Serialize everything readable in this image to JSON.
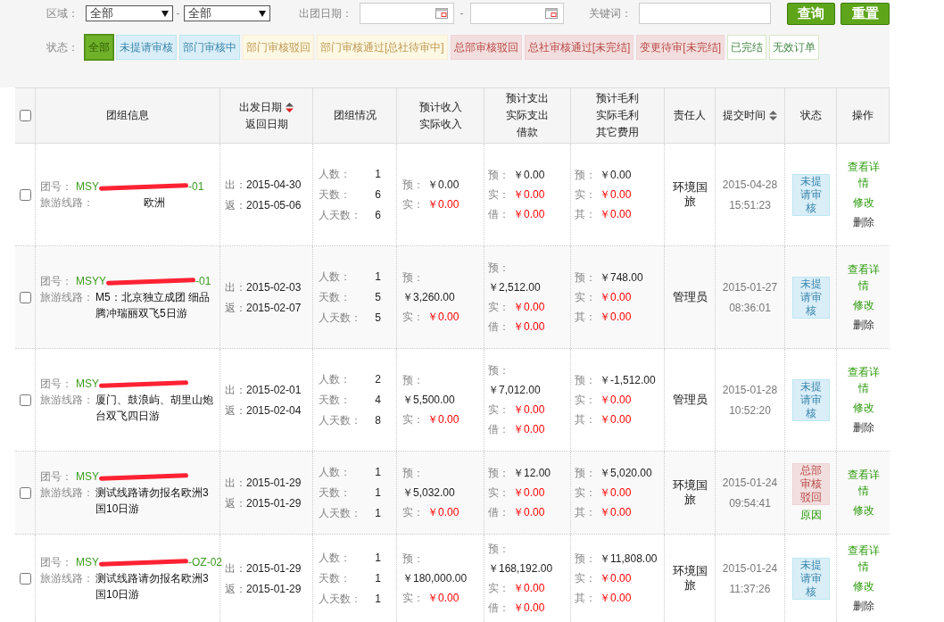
{
  "filters": {
    "region_label": "区域：",
    "region_1": "全部",
    "separator_1": "-",
    "region_2": "全部",
    "date_label": "出团日期：",
    "separator_2": "-",
    "keyword_label": "关键词：",
    "search_button": "查询",
    "reset_button": "重置"
  },
  "status_label": "状态：",
  "status_chips": [
    {
      "label": "全部",
      "kind": "all",
      "selected": true
    },
    {
      "label": "未提请审核",
      "kind": "blue",
      "selected": false
    },
    {
      "label": "部门审核中",
      "kind": "blue",
      "selected": false
    },
    {
      "label": "部门审核驳回",
      "kind": "orange",
      "selected": false
    },
    {
      "label": "部门审核通过[总社待审中]",
      "kind": "orange",
      "selected": false
    },
    {
      "label": "总部审核驳回",
      "kind": "red",
      "selected": false
    },
    {
      "label": "总社审核通过[未完结]",
      "kind": "red",
      "selected": false
    },
    {
      "label": "变更待审[未完结]",
      "kind": "red",
      "selected": false
    },
    {
      "label": "已完结",
      "kind": "green",
      "selected": false
    },
    {
      "label": "无效订单",
      "kind": "green",
      "selected": false
    }
  ],
  "table": {
    "select_all": {
      "checked": false
    },
    "columns": [
      {
        "lines": [
          "团组信息"
        ]
      },
      {
        "lines": [
          "出发日期",
          "返回日期"
        ],
        "sortable": true,
        "sorted": true
      },
      {
        "lines": [
          "团组情况"
        ]
      },
      {
        "lines": [
          "预计收入",
          "实际收入"
        ]
      },
      {
        "lines": [
          "预计支出",
          "实际支出",
          "借款"
        ]
      },
      {
        "lines": [
          "预计毛利",
          "实际毛利",
          "其它费用"
        ]
      },
      {
        "lines": [
          "责任人"
        ]
      },
      {
        "lines": [
          "提交时间"
        ],
        "sortable": true,
        "sorted": false
      },
      {
        "lines": [
          "状态"
        ]
      },
      {
        "lines": [
          "操作"
        ]
      }
    ],
    "rows": [
      {
        "checked": false,
        "no_label": "团号：",
        "no_head": "MSY",
        "no_tail": "-01",
        "route_label": "旅游线路：",
        "route": "欧洲",
        "depart": [
          "出：",
          "2015-04-30"
        ],
        "return": [
          "返：",
          "2015-05-06"
        ],
        "group": [
          [
            "人数：",
            "1"
          ],
          [
            "天数：",
            "6"
          ],
          [
            "人天数：",
            "6"
          ]
        ],
        "income": [
          {
            "label": "预：",
            "value": "￥0.00",
            "kind": "inline"
          },
          {
            "label": "实：",
            "value": "￥0.00",
            "kind": "inline"
          }
        ],
        "expense": [
          {
            "label": "预：",
            "value": "￥0.00",
            "kind": "inline"
          },
          {
            "label": "实：",
            "value": "￥0.00",
            "kind": "inline"
          },
          {
            "label": "借：",
            "value": "￥0.00",
            "kind": "inline"
          }
        ],
        "profit": [
          {
            "label": "预：",
            "value": "￥0.00",
            "kind": "inline"
          },
          {
            "label": "实：",
            "value": "￥0.00",
            "kind": "inline"
          },
          {
            "label": "其：",
            "value": "￥0.00",
            "kind": "inline"
          }
        ],
        "owner": "环境国旅",
        "time": [
          "2015-04-28",
          "15:51:23"
        ],
        "status": {
          "label": "未提请审核",
          "kind": "blue"
        },
        "actions": [
          "查看详情",
          "修改",
          "删除"
        ]
      },
      {
        "checked": false,
        "no_label": "团号：",
        "no_head": "MSYY",
        "no_tail": "-01",
        "route_label": "旅游线路：",
        "route": "M5：北京独立成团 细品腾冲瑞丽双飞5日游",
        "depart": [
          "出：",
          "2015-02-03"
        ],
        "return": [
          "返：",
          "2015-02-07"
        ],
        "group": [
          [
            "人数：",
            "1"
          ],
          [
            "天数：",
            "5"
          ],
          [
            "人天数：",
            "5"
          ]
        ],
        "income": [
          {
            "label": "预：",
            "value": "￥3,260.00",
            "kind": "stacked"
          },
          {
            "label": "实：",
            "value": "￥0.00",
            "kind": "inline"
          }
        ],
        "expense": [
          {
            "label": "预：",
            "value": "￥2,512.00",
            "kind": "stacked"
          },
          {
            "label": "实：",
            "value": "￥0.00",
            "kind": "inline"
          },
          {
            "label": "借：",
            "value": "￥0.00",
            "kind": "inline"
          }
        ],
        "profit": [
          {
            "label": "预：",
            "value": "￥748.00",
            "kind": "inline"
          },
          {
            "label": "实：",
            "value": "￥0.00",
            "kind": "inline"
          },
          {
            "label": "其：",
            "value": "￥0.00",
            "kind": "inline"
          }
        ],
        "owner": "管理员",
        "time": [
          "2015-01-27",
          "08:36:01"
        ],
        "status": {
          "label": "未提请审核",
          "kind": "blue"
        },
        "actions": [
          "查看详情",
          "修改",
          "删除"
        ]
      },
      {
        "checked": false,
        "no_label": "团号：",
        "no_head": "MSY",
        "route_label": "旅游线路：",
        "route": "厦门、鼓浪屿、胡里山炮台双飞四日游",
        "depart": [
          "出：",
          "2015-02-01"
        ],
        "return": [
          "返：",
          "2015-02-04"
        ],
        "group": [
          [
            "人数：",
            "2"
          ],
          [
            "天数：",
            "4"
          ],
          [
            "人天数：",
            "8"
          ]
        ],
        "income": [
          {
            "label": "预：",
            "value": "￥5,500.00",
            "kind": "stacked"
          },
          {
            "label": "实：",
            "value": "￥0.00",
            "kind": "inline"
          }
        ],
        "expense": [
          {
            "label": "预：",
            "value": "￥7,012.00",
            "kind": "stacked"
          },
          {
            "label": "实：",
            "value": "￥0.00",
            "kind": "inline"
          },
          {
            "label": "借：",
            "value": "￥0.00",
            "kind": "inline"
          }
        ],
        "profit": [
          {
            "label": "预：",
            "value": "￥-1,512.00",
            "kind": "inline"
          },
          {
            "label": "实：",
            "value": "￥0.00",
            "kind": "inline"
          },
          {
            "label": "其：",
            "value": "￥0.00",
            "kind": "inline"
          }
        ],
        "owner": "管理员",
        "time": [
          "2015-01-28",
          "10:52:20"
        ],
        "status": {
          "label": "未提请审核",
          "kind": "blue"
        },
        "actions": [
          "查看详情",
          "修改",
          "删除"
        ]
      },
      {
        "checked": false,
        "no_label": "团号：",
        "no_head": "MSY",
        "route_label": "旅游线路：",
        "route": "测试线路请勿报名欧洲3国10日游",
        "depart": [
          "出：",
          "2015-01-29"
        ],
        "return": [
          "返：",
          "2015-01-29"
        ],
        "group": [
          [
            "人数：",
            "1"
          ],
          [
            "天数：",
            "1"
          ],
          [
            "人天数：",
            "1"
          ]
        ],
        "income": [
          {
            "label": "预：",
            "value": "￥5,032.00",
            "kind": "stacked"
          },
          {
            "label": "实：",
            "value": "￥0.00",
            "kind": "inline"
          }
        ],
        "expense": [
          {
            "label": "预：",
            "value": "￥12.00",
            "kind": "inline"
          },
          {
            "label": "实：",
            "value": "￥0.00",
            "kind": "inline"
          },
          {
            "label": "借：",
            "value": "￥0.00",
            "kind": "inline"
          }
        ],
        "profit": [
          {
            "label": "预：",
            "value": "￥5,020.00",
            "kind": "inline"
          },
          {
            "label": "实：",
            "value": "￥0.00",
            "kind": "inline"
          },
          {
            "label": "其：",
            "value": "￥0.00",
            "kind": "inline"
          }
        ],
        "owner": "环境国旅",
        "time": [
          "2015-01-24",
          "09:54:41"
        ],
        "status": {
          "label": "总部审核驳回",
          "kind": "red",
          "reason": "原因"
        },
        "actions": [
          "查看详情",
          "修改"
        ]
      },
      {
        "checked": false,
        "no_label": "团号：",
        "no_head": "MSY",
        "no_tail": "-OZ-02",
        "route_label": "旅游线路：",
        "route": "测试线路请勿报名欧洲3国10日游",
        "depart": [
          "出：",
          "2015-01-29"
        ],
        "return": [
          "返：",
          "2015-01-29"
        ],
        "group": [
          [
            "人数：",
            "1"
          ],
          [
            "天数：",
            "1"
          ],
          [
            "人天数：",
            "1"
          ]
        ],
        "income": [
          {
            "label": "预：",
            "value": "￥180,000.00",
            "kind": "stacked"
          },
          {
            "label": "实：",
            "value": "￥0.00",
            "kind": "inline"
          }
        ],
        "expense": [
          {
            "label": "预：",
            "value": "￥168,192.00",
            "kind": "stacked"
          },
          {
            "label": "实：",
            "value": "￥0.00",
            "kind": "inline"
          },
          {
            "label": "借：",
            "value": "￥0.00",
            "kind": "inline"
          }
        ],
        "profit": [
          {
            "label": "预：",
            "value": "￥11,808.00",
            "kind": "inline"
          },
          {
            "label": "实：",
            "value": "￥0.00",
            "kind": "inline"
          },
          {
            "label": "其：",
            "value": "￥0.00",
            "kind": "inline"
          }
        ],
        "owner": "环境国旅",
        "time": [
          "2015-01-24",
          "11:37:26"
        ],
        "status": {
          "label": "未提请审核",
          "kind": "blue"
        },
        "actions": [
          "查看详情",
          "修改",
          "删除"
        ]
      }
    ]
  }
}
